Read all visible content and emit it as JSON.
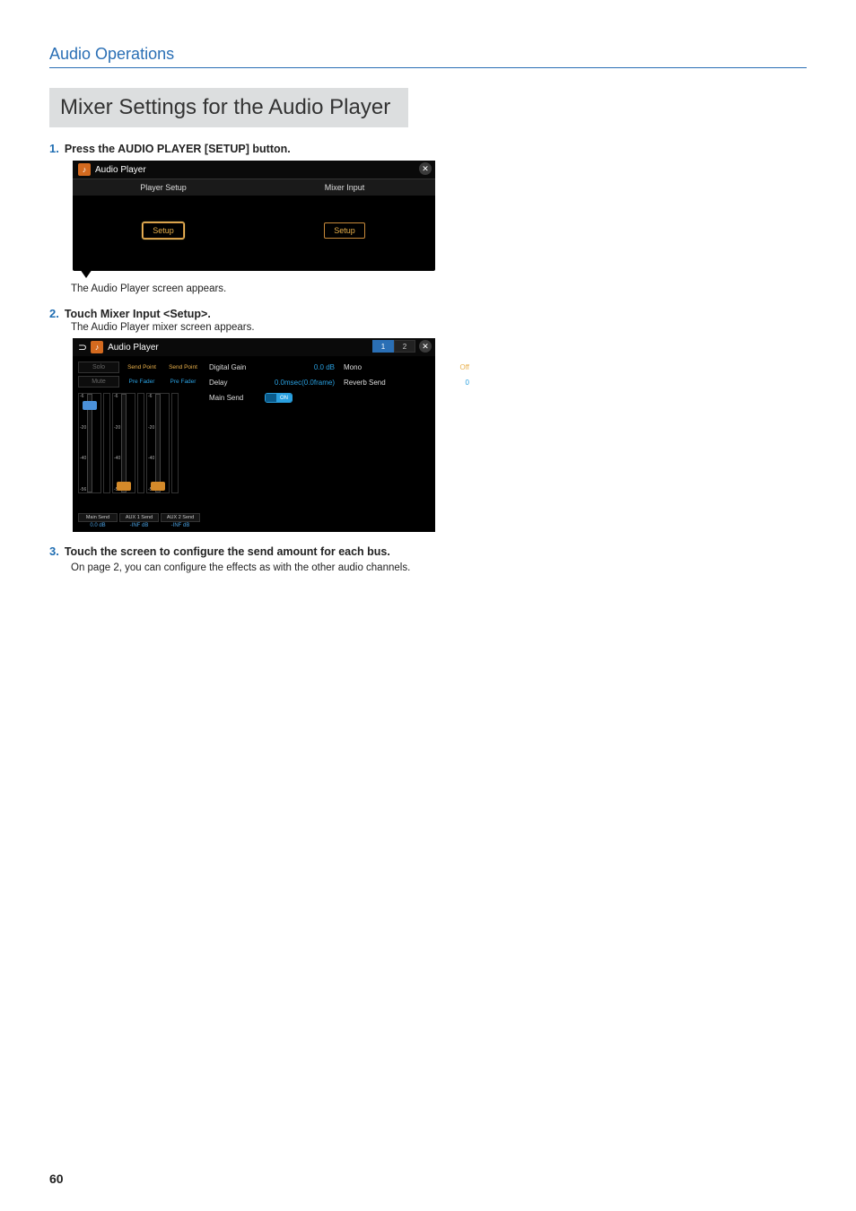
{
  "section_header": "Audio Operations",
  "title": "Mixer Settings for the Audio Player",
  "steps": [
    {
      "num": "1.",
      "text": "Press the AUDIO PLAYER [SETUP] button.",
      "after": "The Audio Player screen appears."
    },
    {
      "num": "2.",
      "text": "Touch Mixer Input <Setup>.",
      "sub": "The Audio Player mixer screen appears."
    },
    {
      "num": "3.",
      "text": "Touch the screen to configure the send amount for each bus.",
      "sub2": "On page 2, you can configure the effects as with the other audio channels."
    }
  ],
  "shot1": {
    "title": "Audio Player",
    "tab_left": "Player Setup",
    "tab_right": "Mixer Input",
    "setup": "Setup"
  },
  "shot2": {
    "title": "Audio Player",
    "page1": "1",
    "page2": "2",
    "solo": "Solo",
    "mute": "Mute",
    "send_point": "Send Point",
    "pre_fader": "Pre Fader",
    "scale": [
      "-6",
      "-20",
      "-40",
      "-56"
    ],
    "main_send": "Main Send",
    "aux1_send": "AUX 1 Send",
    "aux2_send": "AUX 2 Send",
    "main_val": "0.0 dB",
    "aux1_val": "-INF dB",
    "aux2_val": "-INF dB",
    "params": {
      "digital_gain_l": "Digital Gain",
      "digital_gain_v": "0.0 dB",
      "mono_l": "Mono",
      "mono_v": "Off",
      "delay_l": "Delay",
      "delay_v": "0.0msec(0.0frame)",
      "reverb_l": "Reverb Send",
      "reverb_v": "0",
      "mainsend_l": "Main Send",
      "mainsend_v": "ON"
    }
  },
  "page_number": "60"
}
